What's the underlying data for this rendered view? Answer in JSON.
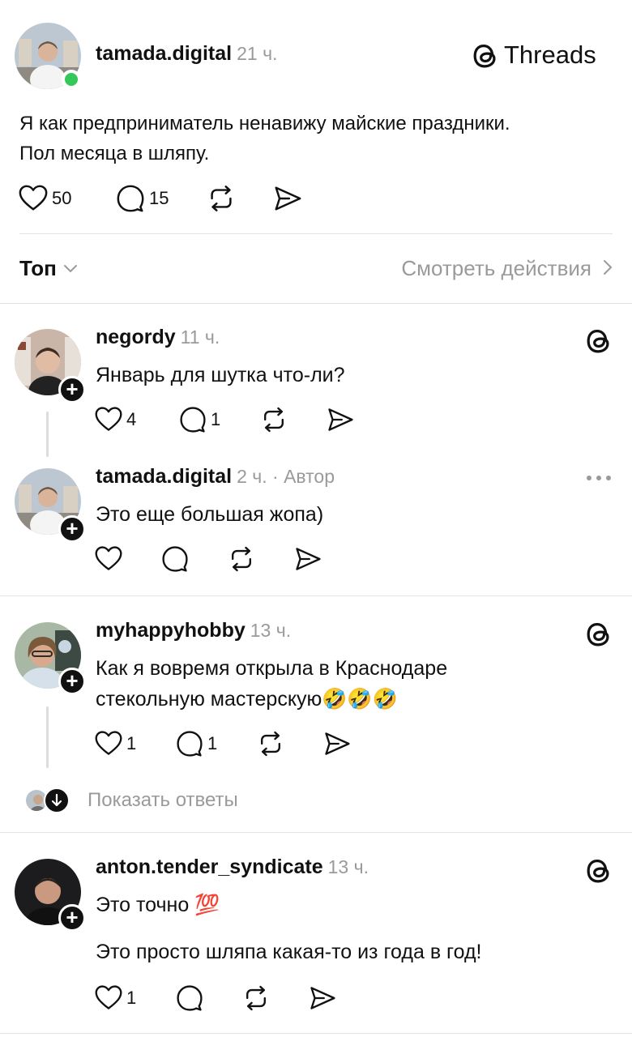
{
  "header": {
    "brand": "Threads"
  },
  "post": {
    "username": "tamada.digital",
    "time": "21 ч.",
    "text_line1": "Я как предприниматель ненавижу майские праздники.",
    "text_line2": "Пол месяца в шляпу.",
    "likes": "50",
    "replies": "15"
  },
  "sort_bar": {
    "label": "Топ",
    "view_activity": "Смотреть действия"
  },
  "comments": [
    {
      "username": "negordy",
      "time": "11 ч.",
      "text": "Январь для шутка что-ли?",
      "likes": "4",
      "replies": "1"
    },
    {
      "username": "tamada.digital",
      "time": "2 ч. · Автор",
      "text": "Это еще большая жопа)"
    },
    {
      "username": "myhappyhobby",
      "time": "13 ч.",
      "text_line1": "Как я вовремя открыла в Краснодаре",
      "text_line2": "стекольную мастерскую🤣🤣🤣",
      "likes": "1",
      "replies": "1",
      "show_replies": "Показать ответы"
    },
    {
      "username": "anton.tender_syndicate",
      "time": "13 ч.",
      "text_line1": "Это точно 💯",
      "text_line2": "Это просто шляпа какая-то из года в год!",
      "likes": "1"
    }
  ],
  "icons": [
    "threads-logo-icon",
    "heart-icon",
    "comment-icon",
    "repost-icon",
    "share-icon",
    "chevron-down-icon",
    "chevron-right-icon",
    "more-icon",
    "plus-icon",
    "arrow-down-icon"
  ],
  "colors": {
    "text": "#111111",
    "muted": "#9a9a9a",
    "online": "#35c759",
    "divider": "#e3e3e3"
  }
}
